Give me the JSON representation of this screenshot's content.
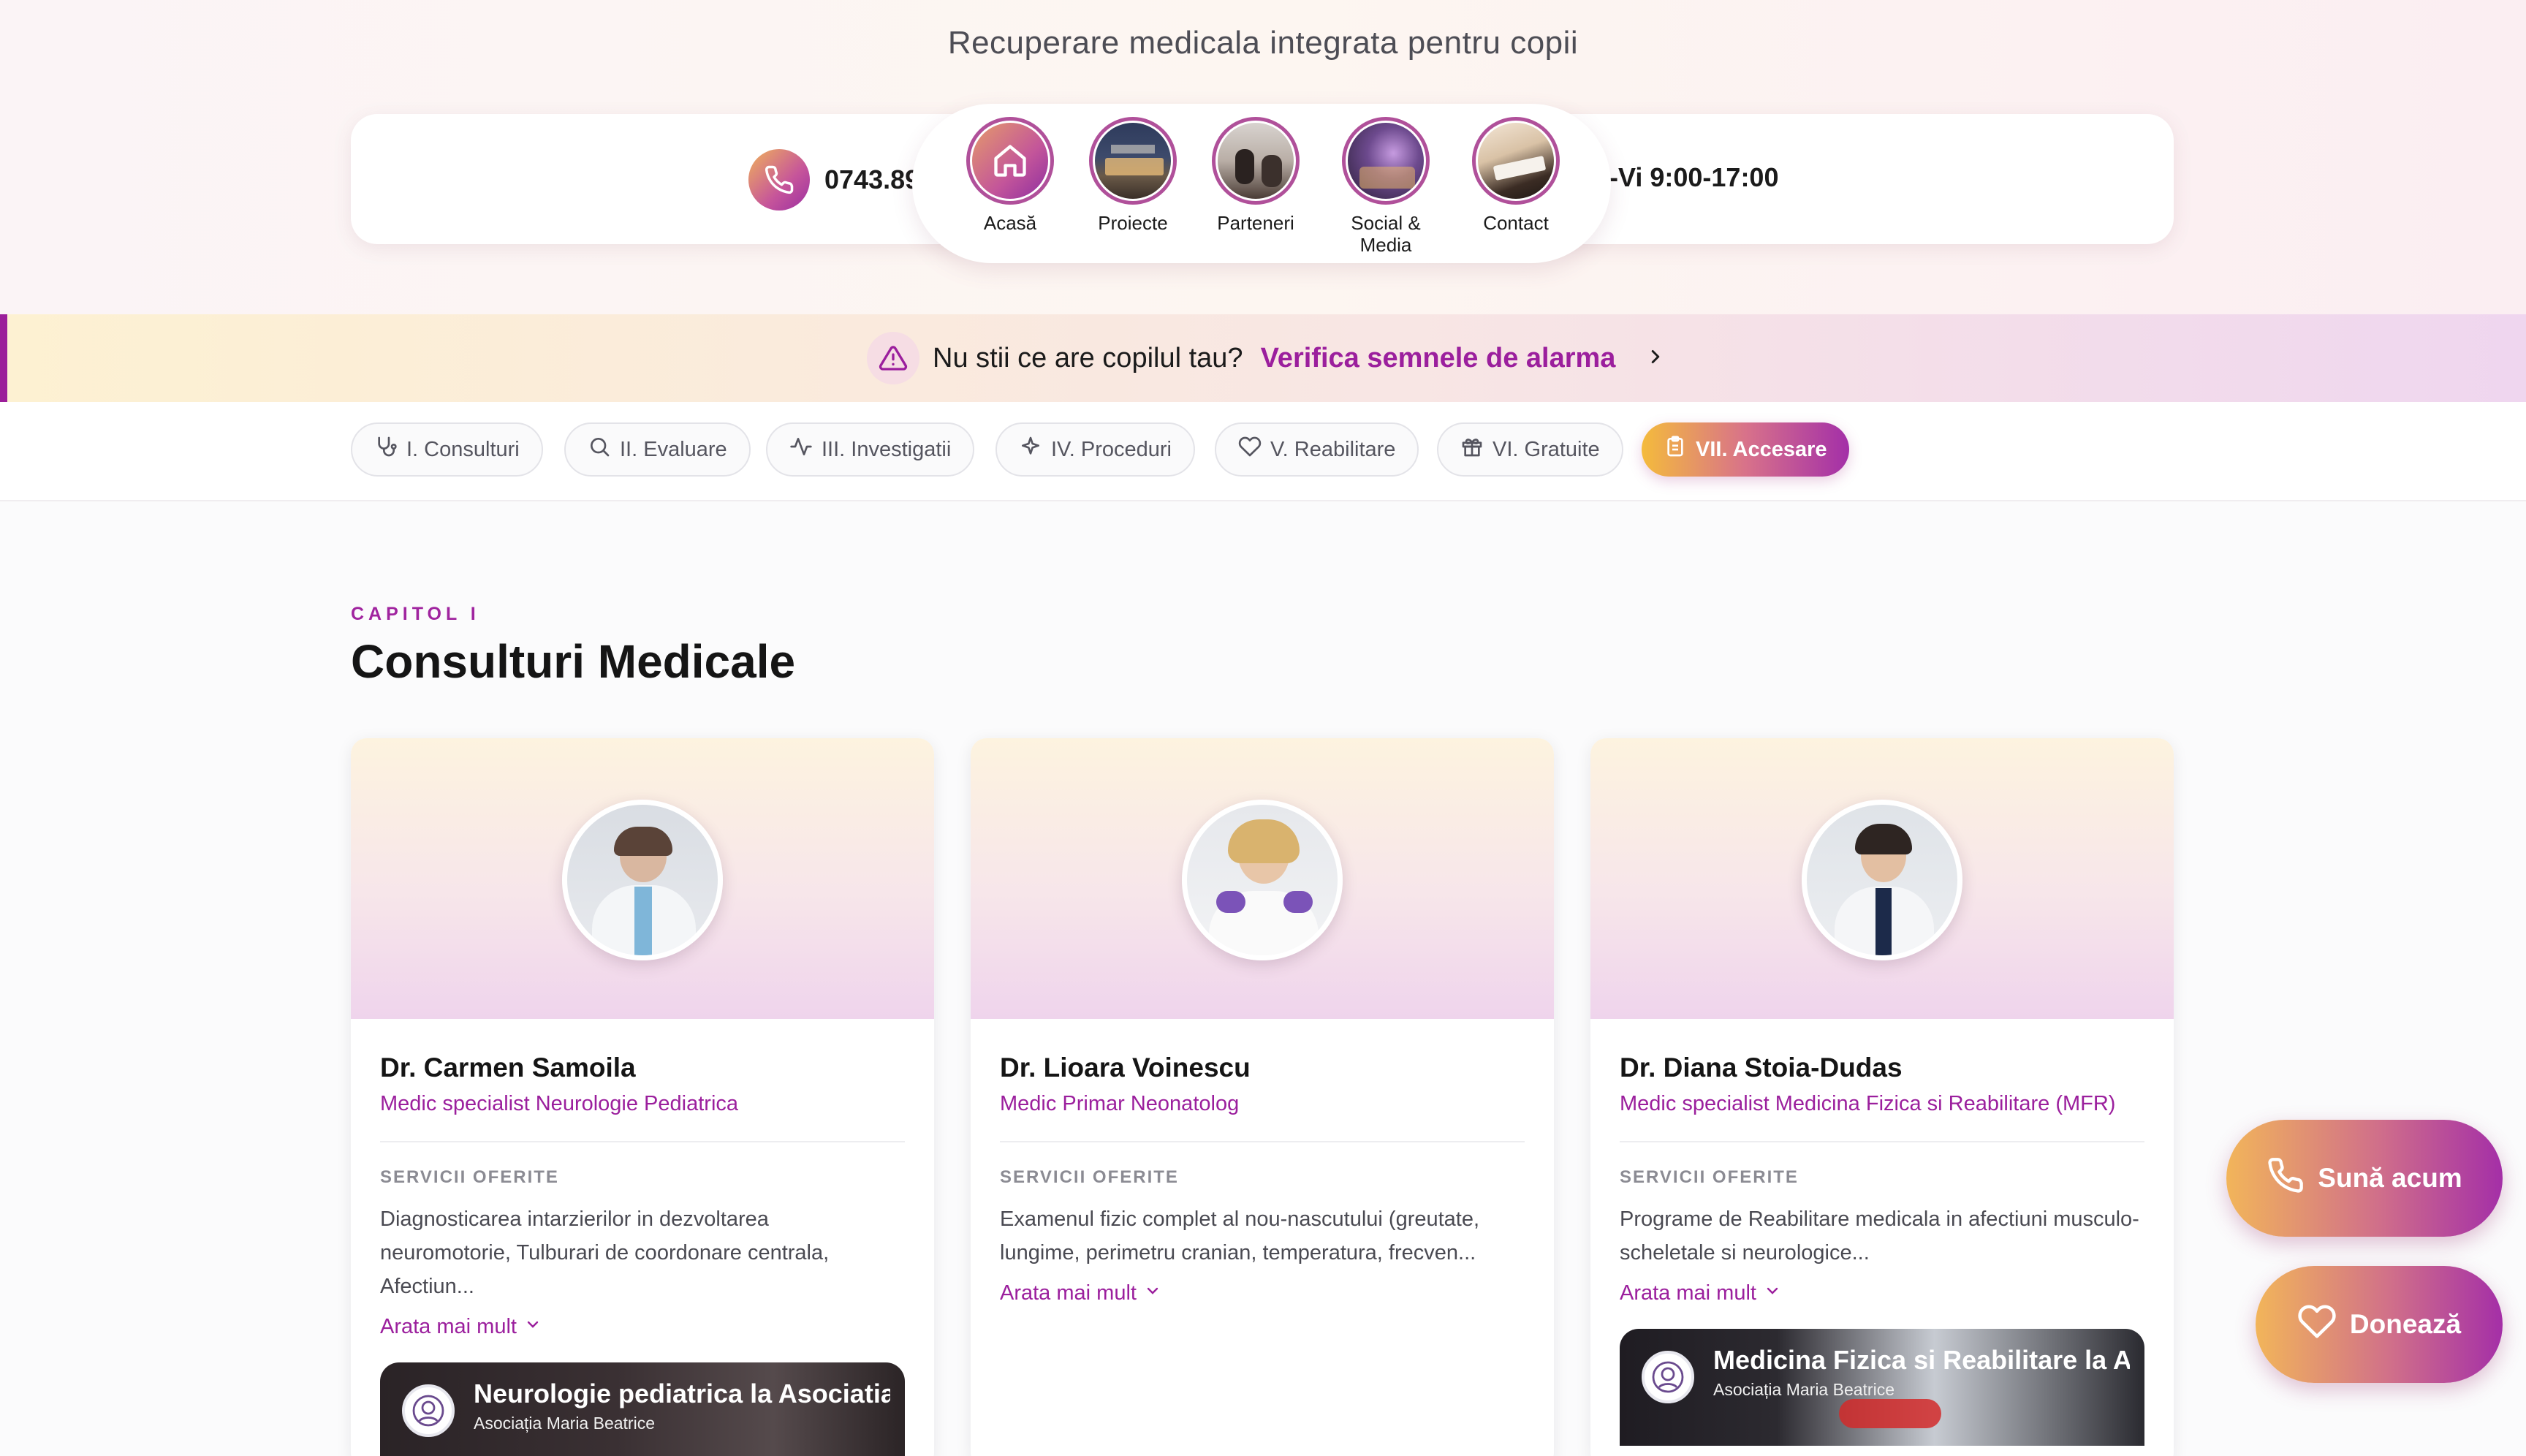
{
  "header": {
    "tagline": "Recuperare medicala integrata pentru copii",
    "phone": "0743.89",
    "hours": "-Vi 9:00-17:00"
  },
  "nav": {
    "items": [
      {
        "label": "Acasă",
        "icon": "home-icon"
      },
      {
        "label": "Proiecte",
        "icon": "building-photo"
      },
      {
        "label": "Parteneri",
        "icon": "meeting-photo"
      },
      {
        "label": "Social &",
        "label2": "Media",
        "icon": "event-photo"
      },
      {
        "label": "Contact",
        "icon": "desk-photo"
      }
    ]
  },
  "alarm": {
    "text": "Nu stii ce are copilul tau?",
    "link": "Verifica semnele de alarma"
  },
  "chapters": [
    {
      "label": "I. Consulturi",
      "icon": "stethoscope-icon"
    },
    {
      "label": "II. Evaluare",
      "icon": "search-icon"
    },
    {
      "label": "III. Investigatii",
      "icon": "pulse-icon"
    },
    {
      "label": "IV. Proceduri",
      "icon": "sparkle-icon"
    },
    {
      "label": "V. Reabilitare",
      "icon": "heart-icon"
    },
    {
      "label": "VI. Gratuite",
      "icon": "gift-icon"
    },
    {
      "label": "VII. Accesare",
      "icon": "clipboard-icon",
      "active": true
    }
  ],
  "section": {
    "kicker": "CAPITOL I",
    "title": "Consulturi Medicale"
  },
  "doctors": [
    {
      "name": "Dr. Carmen Samoila",
      "role": "Medic specialist Neurologie Pediatrica",
      "services_label": "SERVICII OFERITE",
      "services": "Diagnosticarea intarzierilor in dezvoltarea neuromotorie, Tulburari de coordonare centrala, Afectiun...",
      "more": "Arata mai mult",
      "video": {
        "title": "Neurologie pediatrica la Asociatia M",
        "channel": "Asociația Maria Beatrice"
      }
    },
    {
      "name": "Dr. Lioara Voinescu",
      "role": "Medic Primar Neonatolog",
      "services_label": "SERVICII OFERITE",
      "services": "Examenul fizic complet al nou-nascutului (greutate, lungime, perimetru cranian, temperatura, frecven...",
      "more": "Arata mai mult"
    },
    {
      "name": "Dr. Diana Stoia-Dudas",
      "role": "Medic specialist Medicina Fizica si Reabilitare (MFR)",
      "services_label": "SERVICII OFERITE",
      "services": "Programe de Reabilitare medicala in afectiuni musculo-scheletale si neurologice...",
      "more": "Arata mai mult",
      "video": {
        "title": "Medicina Fizica si Reabilitare la Asoc",
        "channel": "Asociația Maria Beatrice"
      }
    }
  ],
  "fabs": {
    "call": "Sună acum",
    "donate": "Donează"
  },
  "colors": {
    "accent": "#9b1f9d",
    "gradient_start": "#f4bb3c",
    "gradient_end": "#a32fa8"
  }
}
